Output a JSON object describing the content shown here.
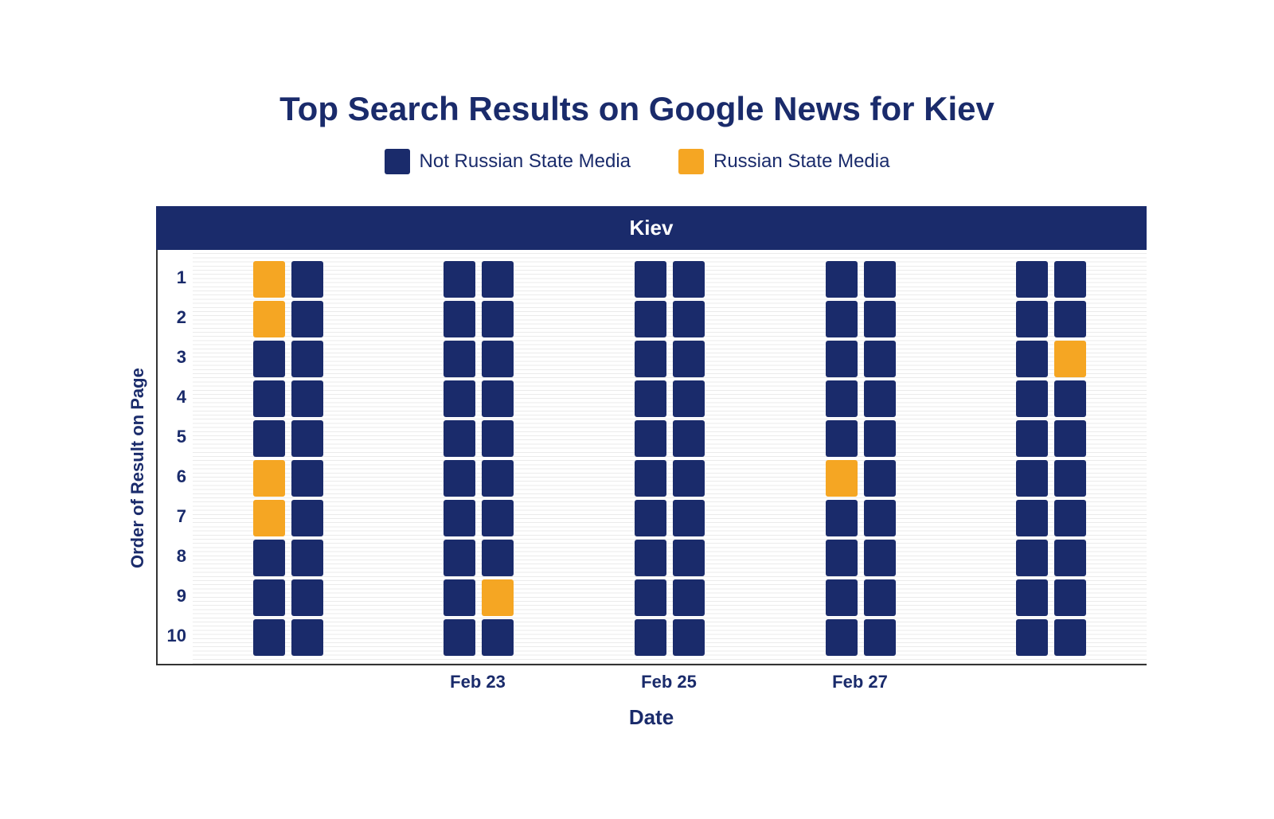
{
  "title": "Top Search Results on Google News for Kiev",
  "legend": {
    "items": [
      {
        "label": "Not Russian State Media",
        "color": "navy"
      },
      {
        "label": "Russian State Media",
        "color": "orange"
      }
    ]
  },
  "colors": {
    "navy": "#1a2b6b",
    "orange": "#f5a623",
    "white": "#ffffff"
  },
  "chart": {
    "group_label": "Kiev",
    "y_axis_label": "Order of Result on Page",
    "x_axis_label": "Date",
    "y_ticks": [
      "1",
      "2",
      "3",
      "4",
      "5",
      "6",
      "7",
      "8",
      "9",
      "10"
    ],
    "dates": [
      {
        "label": "",
        "columns": [
          [
            "orange",
            "orange",
            "navy",
            "navy",
            "navy",
            "orange",
            "orange",
            "navy",
            "navy",
            "navy"
          ],
          [
            "navy",
            "navy",
            "navy",
            "navy",
            "navy",
            "navy",
            "navy",
            "navy",
            "navy",
            "navy"
          ]
        ]
      },
      {
        "label": "Feb 23",
        "columns": [
          [
            "navy",
            "navy",
            "navy",
            "navy",
            "navy",
            "navy",
            "navy",
            "navy",
            "navy",
            "navy"
          ],
          [
            "navy",
            "navy",
            "navy",
            "navy",
            "navy",
            "navy",
            "navy",
            "navy",
            "orange",
            "navy"
          ]
        ]
      },
      {
        "label": "Feb 25",
        "columns": [
          [
            "navy",
            "navy",
            "navy",
            "navy",
            "navy",
            "navy",
            "navy",
            "navy",
            "navy",
            "navy"
          ],
          [
            "navy",
            "navy",
            "navy",
            "navy",
            "navy",
            "navy",
            "navy",
            "navy",
            "navy",
            "navy"
          ]
        ]
      },
      {
        "label": "Feb 27",
        "columns": [
          [
            "navy",
            "navy",
            "navy",
            "navy",
            "navy",
            "orange",
            "navy",
            "navy",
            "navy",
            "navy"
          ],
          [
            "navy",
            "navy",
            "navy",
            "navy",
            "navy",
            "navy",
            "navy",
            "navy",
            "navy",
            "navy"
          ]
        ]
      },
      {
        "label": "",
        "columns": [
          [
            "navy",
            "navy",
            "navy",
            "navy",
            "navy",
            "navy",
            "navy",
            "navy",
            "navy",
            "navy"
          ],
          [
            "navy",
            "navy",
            "orange",
            "navy",
            "navy",
            "navy",
            "navy",
            "navy",
            "navy",
            "navy"
          ]
        ]
      }
    ]
  }
}
